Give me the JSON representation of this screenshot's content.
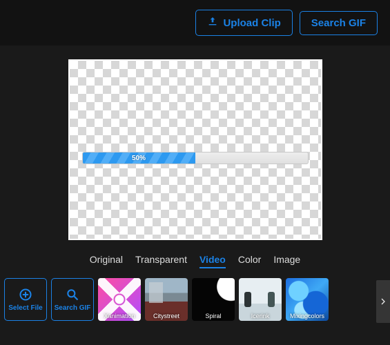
{
  "top": {
    "upload_label": "Upload Clip",
    "search_label": "Search GIF"
  },
  "progress": {
    "percent": 50,
    "label": "50%"
  },
  "background_tabs": {
    "items": [
      {
        "label": "Original",
        "active": false
      },
      {
        "label": "Transparent",
        "active": false
      },
      {
        "label": "Video",
        "active": true
      },
      {
        "label": "Color",
        "active": false
      },
      {
        "label": "Image",
        "active": false
      }
    ]
  },
  "actions": {
    "select_file_label": "Select File",
    "search_gif_label": "Search GIF"
  },
  "thumbnails": [
    {
      "label": "Xanimation"
    },
    {
      "label": "Citystreet"
    },
    {
      "label": "Spiral"
    },
    {
      "label": "Icerink"
    },
    {
      "label": "Mixingcolors"
    }
  ],
  "colors": {
    "accent": "#1b82e6"
  }
}
